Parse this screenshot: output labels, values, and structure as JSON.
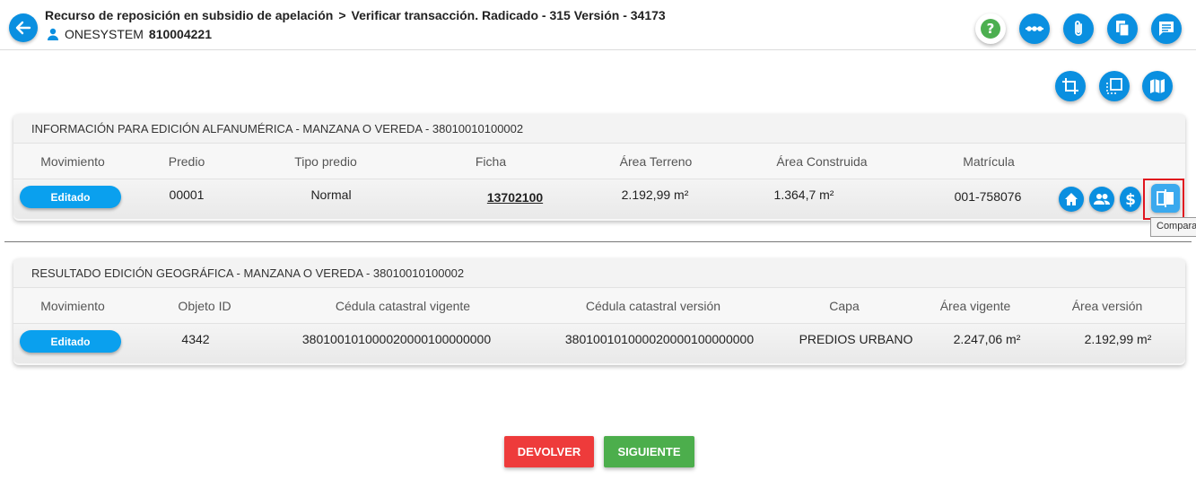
{
  "header": {
    "breadcrumb_1": "Recurso de reposición en subsidio de apelación",
    "breadcrumb_sep": ">",
    "breadcrumb_2": "Verificar transacción. Radicado - 315 Versión - 34173",
    "user_name": "ONESYSTEM",
    "user_id": "810004221"
  },
  "header_icons": [
    "help-icon",
    "more-icon",
    "attachment-icon",
    "copy-icon",
    "comments-icon"
  ],
  "tool_icons": [
    "crop-icon",
    "layers-icon",
    "map-icon"
  ],
  "colors": {
    "accent": "#0a8fe0",
    "danger": "#ee3b3b",
    "success": "#4cae4c",
    "help": "#4caf50"
  },
  "alfa": {
    "title": "INFORMACIÓN PARA EDICIÓN ALFANUMÉRICA - MANZANA O VEREDA - 38010010100002",
    "columns": [
      "Movimiento",
      "Predio",
      "Tipo predio",
      "Ficha",
      "Área Terreno",
      "Área Construida",
      "Matrícula"
    ],
    "row": {
      "movimiento": "Editado",
      "predio": "00001",
      "tipo": "Normal",
      "ficha": "13702100",
      "area_terreno": "2.192,99 m²",
      "area_construida": "1.364,7 m²",
      "matricula": "001-758076"
    },
    "row_icons": [
      "home-icon",
      "people-icon",
      "dollar-icon",
      "compare-icon"
    ],
    "tooltip": "Comparar"
  },
  "geo": {
    "title": "RESULTADO EDICIÓN GEOGRÁFICA - MANZANA O VEREDA - 38010010100002",
    "columns": [
      "Movimiento",
      "Objeto ID",
      "Cédula catastral vigente",
      "Cédula catastral versión",
      "Capa",
      "Área vigente",
      "Área versión"
    ],
    "row": {
      "movimiento": "Editado",
      "objeto_id": "4342",
      "cedula_vigente": "380100101000020000100000000",
      "cedula_version": "380100101000020000100000000",
      "capa": "PREDIOS URBANO",
      "area_vigente": "2.247,06 m²",
      "area_version": "2.192,99 m²"
    }
  },
  "actions": {
    "devolver": "DEVOLVER",
    "siguiente": "SIGUIENTE"
  }
}
